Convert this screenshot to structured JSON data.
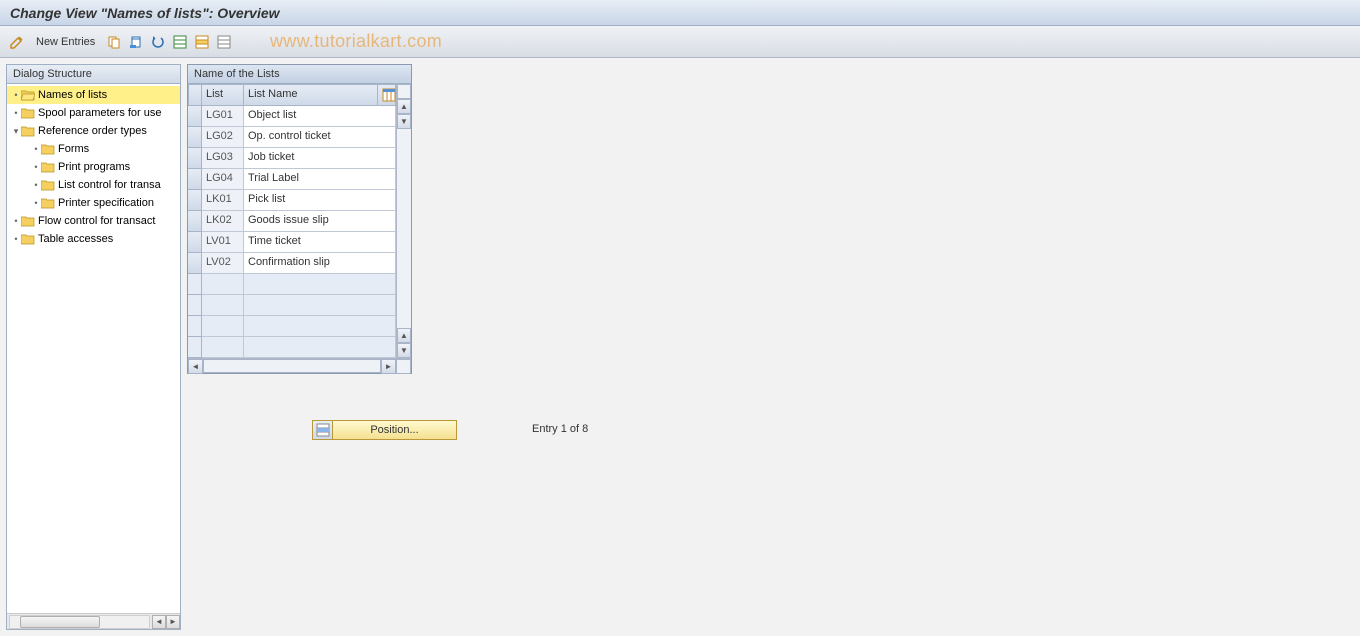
{
  "title": "Change View \"Names of lists\": Overview",
  "toolbar": {
    "new_entries": "New Entries"
  },
  "watermark": "www.tutorialkart.com",
  "tree": {
    "header": "Dialog Structure",
    "nodes": [
      {
        "label": "Names of lists",
        "level": 0,
        "toggle": "•",
        "folder": "open",
        "selected": true
      },
      {
        "label": "Spool parameters for use",
        "level": 0,
        "toggle": "•",
        "folder": "closed",
        "selected": false
      },
      {
        "label": "Reference order types",
        "level": 0,
        "toggle": "▾",
        "folder": "closed",
        "selected": false
      },
      {
        "label": "Forms",
        "level": 1,
        "toggle": "•",
        "folder": "closed",
        "selected": false
      },
      {
        "label": "Print programs",
        "level": 1,
        "toggle": "•",
        "folder": "closed",
        "selected": false
      },
      {
        "label": "List control for transa",
        "level": 1,
        "toggle": "•",
        "folder": "closed",
        "selected": false
      },
      {
        "label": "Printer specification",
        "level": 1,
        "toggle": "•",
        "folder": "closed",
        "selected": false
      },
      {
        "label": "Flow control for transact",
        "level": 0,
        "toggle": "•",
        "folder": "closed",
        "selected": false
      },
      {
        "label": "Table accesses",
        "level": 0,
        "toggle": "•",
        "folder": "closed",
        "selected": false
      }
    ]
  },
  "table": {
    "title": "Name of the Lists",
    "headers": {
      "list": "List",
      "name": "List Name"
    },
    "rows": [
      {
        "code": "LG01",
        "name": "Object list"
      },
      {
        "code": "LG02",
        "name": "Op. control ticket"
      },
      {
        "code": "LG03",
        "name": "Job ticket"
      },
      {
        "code": "LG04",
        "name": "Trial Label"
      },
      {
        "code": "LK01",
        "name": "Pick list"
      },
      {
        "code": "LK02",
        "name": "Goods issue slip"
      },
      {
        "code": "LV01",
        "name": "Time ticket"
      },
      {
        "code": "LV02",
        "name": "Confirmation slip"
      }
    ],
    "empty_rows": 4
  },
  "position_button": "Position...",
  "entry_text": "Entry 1 of 8"
}
